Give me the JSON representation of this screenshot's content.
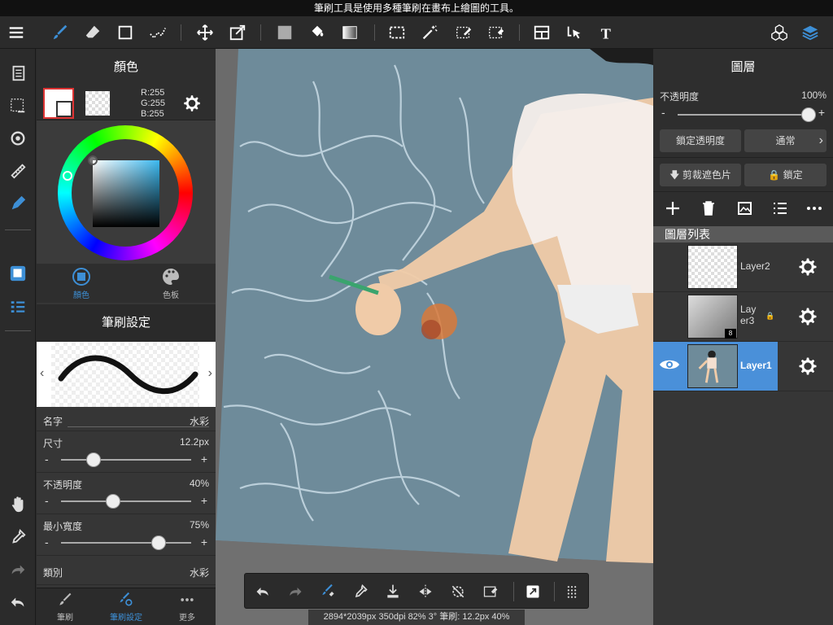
{
  "hint_text": "筆刷工具是使用多種筆刷在畫布上繪圖的工具。",
  "color_panel": {
    "title": "顏色",
    "rgb_r": "R:255",
    "rgb_g": "G:255",
    "rgb_b": "B:255",
    "tab_color": "顏色",
    "tab_palette": "色板"
  },
  "brush_panel": {
    "title": "筆刷設定",
    "name_label": "名字",
    "name_value": "水彩",
    "size_label": "尺寸",
    "size_value": "12.2px",
    "size_level": 0.25,
    "opacity_label": "不透明度",
    "opacity_value": "40%",
    "opacity_level": 0.4,
    "minwidth_label": "最小寬度",
    "minwidth_value": "75%",
    "minwidth_level": 0.75,
    "category_label": "類別",
    "category_value": "水彩",
    "minus": "-",
    "plus": "+"
  },
  "bottom_tabs": {
    "brush": "筆刷",
    "brush_settings": "筆刷設定",
    "more": "更多"
  },
  "layers_panel": {
    "title": "圖層",
    "opacity_label": "不透明度",
    "opacity_value": "100%",
    "opacity_level": 1.0,
    "minus": "-",
    "plus": "+",
    "lock_alpha": "鎖定透明度",
    "blend_mode": "通常",
    "clip": "剪裁遮色片",
    "lock": "鎖定",
    "list_title": "圖層列表",
    "layers": [
      {
        "name": "Layer2",
        "selected": false,
        "visible": false,
        "locked": false,
        "badge": ""
      },
      {
        "name": "Lay\ner3",
        "selected": false,
        "visible": false,
        "locked": true,
        "badge": "8"
      },
      {
        "name": "Layer1",
        "selected": true,
        "visible": true,
        "locked": false,
        "badge": ""
      }
    ]
  },
  "status_bar": "2894*2039px 350dpi 82% 3° 筆刷: 12.2px 40%",
  "colors": {
    "accent": "#3d8fd6",
    "canvas_bg": "#6e8b9a",
    "selected_layer": "#4a90d9"
  },
  "icons": {
    "menu": "menu-icon",
    "brush": "brush-icon",
    "eraser": "eraser-icon",
    "rect": "rectangle-icon",
    "layers": "layers-icon"
  }
}
